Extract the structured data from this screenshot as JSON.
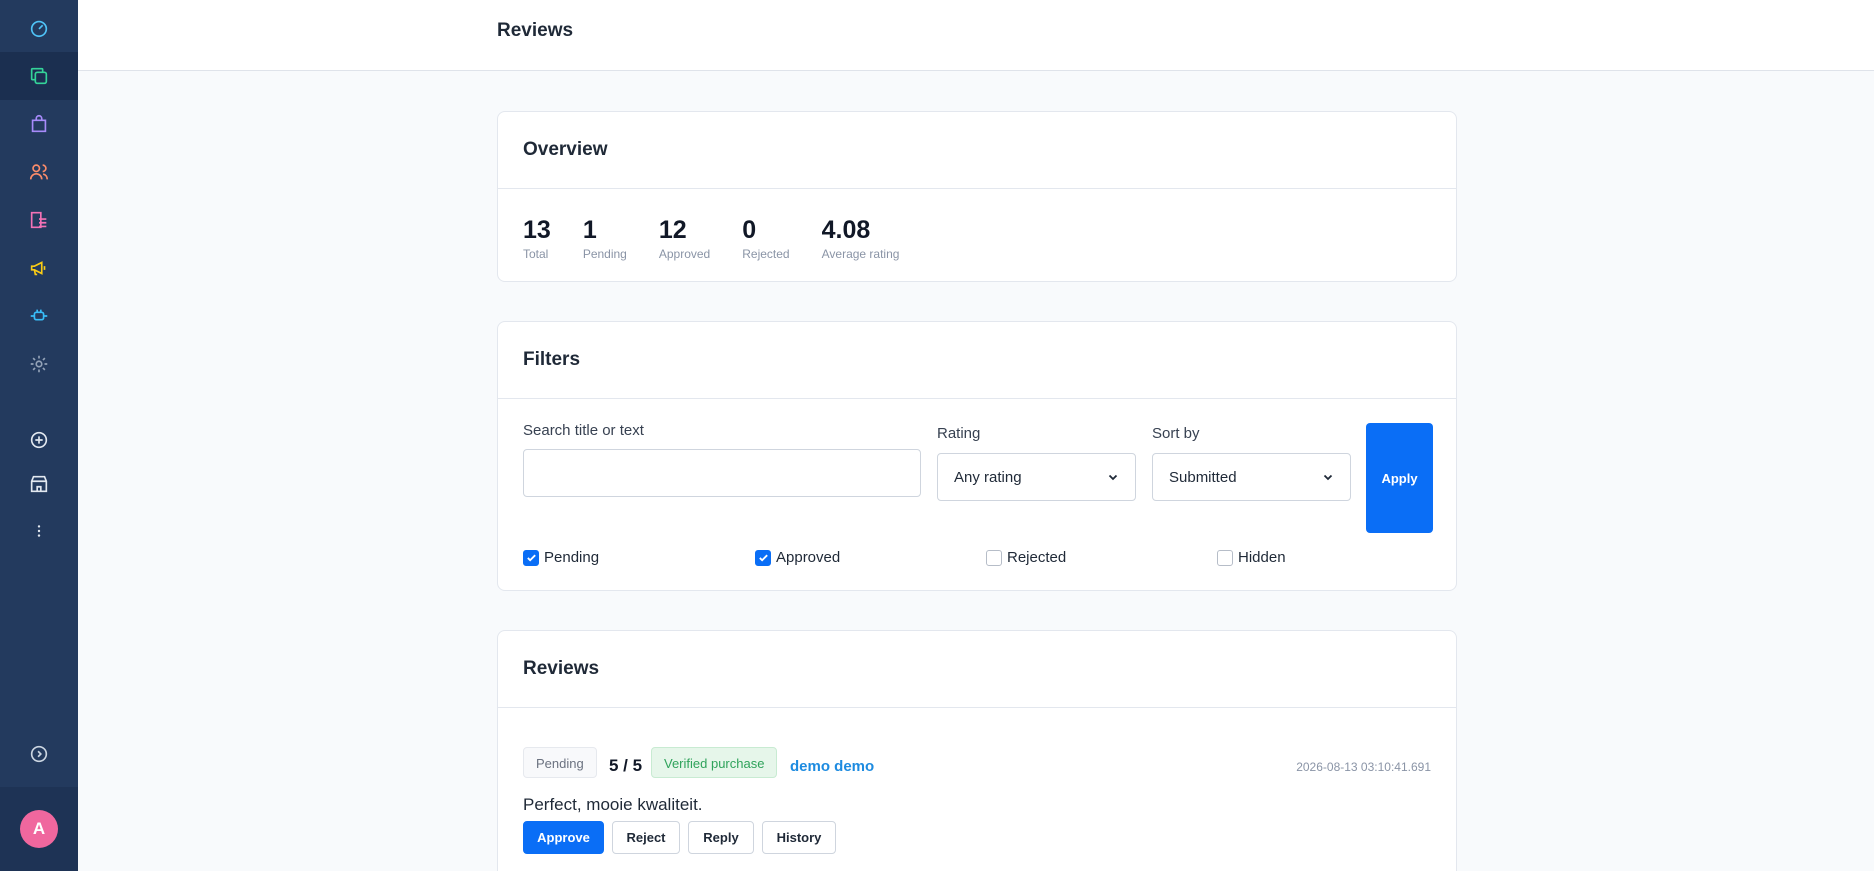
{
  "header": {
    "title": "Reviews"
  },
  "sidebar": {
    "items": [
      {
        "icon": "dashboard-icon",
        "color": "#4fc3f7"
      },
      {
        "icon": "copy-icon",
        "color": "#34d399"
      },
      {
        "icon": "shopping-bag-icon",
        "color": "#a78bfa"
      },
      {
        "icon": "users-icon",
        "color": "#fb8c6a"
      },
      {
        "icon": "list-icon",
        "color": "#f472b6"
      },
      {
        "icon": "megaphone-icon",
        "color": "#facc15"
      },
      {
        "icon": "plug-icon",
        "color": "#38bdf8"
      },
      {
        "icon": "gear-icon",
        "color": "#94a3b8"
      },
      {
        "icon": "plus-circle-icon",
        "color": "#e2e8f0"
      },
      {
        "icon": "store-icon",
        "color": "#e2e8f0"
      },
      {
        "icon": "more-vertical-icon",
        "color": "#e2e8f0"
      },
      {
        "icon": "expand-icon",
        "color": "#cbd5e1"
      }
    ],
    "avatar_initial": "A",
    "avatar_color": "#f0679e"
  },
  "overview": {
    "title": "Overview",
    "stats": [
      {
        "value": "13",
        "label": "Total"
      },
      {
        "value": "1",
        "label": "Pending"
      },
      {
        "value": "12",
        "label": "Approved"
      },
      {
        "value": "0",
        "label": "Rejected"
      },
      {
        "value": "4.08",
        "label": "Average rating"
      }
    ]
  },
  "filters": {
    "title": "Filters",
    "search_label": "Search title or text",
    "search_value": "",
    "rating_label": "Rating",
    "rating_value": "Any rating",
    "sort_label": "Sort by",
    "sort_value": "Submitted",
    "apply_label": "Apply",
    "statuses": [
      {
        "label": "Pending",
        "checked": true
      },
      {
        "label": "Approved",
        "checked": true
      },
      {
        "label": "Rejected",
        "checked": false
      },
      {
        "label": "Hidden",
        "checked": false
      }
    ]
  },
  "reviews": {
    "title": "Reviews",
    "items": [
      {
        "status": "Pending",
        "rating": "5 / 5",
        "verified": "Verified purchase",
        "author": "demo demo",
        "date": "2026-08-13 03:10:41.691",
        "text": "Perfect, mooie kwaliteit.",
        "actions": [
          "Approve",
          "Reject",
          "Reply",
          "History"
        ]
      }
    ]
  },
  "colors": {
    "accent": "#0a6ef6",
    "sidebar": "#233a5e",
    "link": "#1d8be0"
  }
}
